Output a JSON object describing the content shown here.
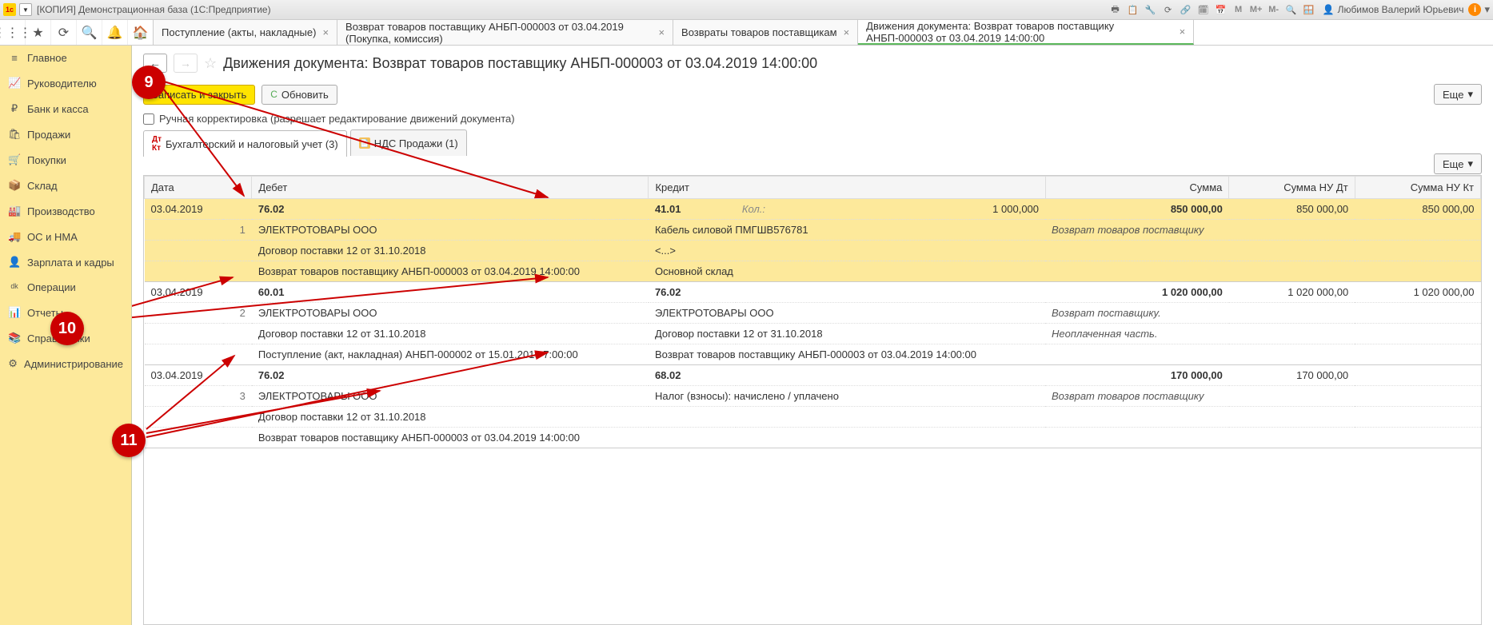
{
  "title_bar": {
    "title": "[КОПИЯ] Демонстрационная база  (1С:Предприятие)",
    "user": "Любимов Валерий Юрьевич",
    "m_icons": [
      "М",
      "М+",
      "М-"
    ]
  },
  "top_tabs": [
    {
      "label": "Поступление (акты, накладные)"
    },
    {
      "label": "Возврат товаров поставщику АНБП-000003 от 03.04.2019 (Покупка, комиссия)"
    },
    {
      "label": "Возвраты товаров поставщикам"
    },
    {
      "label": "Движения документа: Возврат товаров поставщику АНБП-000003 от 03.04.2019 14:00:00",
      "active": true
    }
  ],
  "sidebar": {
    "items": [
      {
        "icon": "≡",
        "label": "Главное"
      },
      {
        "icon": "📈",
        "label": "Руководителю"
      },
      {
        "icon": "₽",
        "label": "Банк и касса"
      },
      {
        "icon": "🛍",
        "label": "Продажи"
      },
      {
        "icon": "🛒",
        "label": "Покупки"
      },
      {
        "icon": "📦",
        "label": "Склад"
      },
      {
        "icon": "🏭",
        "label": "Производство"
      },
      {
        "icon": "🚚",
        "label": "ОС и НМА"
      },
      {
        "icon": "👤",
        "label": "Зарплата и кадры"
      },
      {
        "icon": "ᵈᵏ",
        "label": "Операции"
      },
      {
        "icon": "📊",
        "label": "Отчеты"
      },
      {
        "icon": "📚",
        "label": "Справочники"
      },
      {
        "icon": "⚙",
        "label": "Администрирование"
      }
    ]
  },
  "page": {
    "title": "Движения документа: Возврат товаров поставщику АНБП-000003 от 03.04.2019 14:00:00",
    "save_close": "Записать и закрыть",
    "refresh": "Обновить",
    "more": "Еще",
    "manual_correction": "Ручная корректировка (разрешает редактирование движений документа)"
  },
  "subtabs": [
    {
      "label": "Бухгалтерский и налоговый учет (3)",
      "active": true
    },
    {
      "label": "НДС Продажи (1)"
    }
  ],
  "table": {
    "headers": {
      "date": "Дата",
      "debit": "Дебет",
      "credit": "Кредит",
      "sum": "Сумма",
      "nudt": "Сумма НУ Дт",
      "nukt": "Сумма НУ Кт"
    },
    "qty_label": "Кол.:",
    "subconto_placeholder": "<...>",
    "rows": [
      {
        "n": "1",
        "date": "03.04.2019",
        "debit_acc": "76.02",
        "credit_acc": "41.01",
        "qty": "1 000,000",
        "sum": "850 000,00",
        "nudt": "850 000,00",
        "nukt": "850 000,00",
        "comment": "Возврат товаров поставщику",
        "hl": true,
        "debit_lines": [
          "ЭЛЕКТРОТОВАРЫ ООО",
          "Договор поставки 12 от 31.10.2018",
          "Возврат товаров поставщику АНБП-000003 от 03.04.2019 14:00:00"
        ],
        "credit_lines": [
          "Кабель силовой ПМГШВ576781",
          "<...>",
          "Основной склад"
        ]
      },
      {
        "n": "2",
        "date": "03.04.2019",
        "debit_acc": "60.01",
        "credit_acc": "76.02",
        "sum": "1 020 000,00",
        "nudt": "1 020 000,00",
        "nukt": "1 020 000,00",
        "comment": "Возврат поставщику.",
        "comment2": "Неоплаченная часть.",
        "debit_lines": [
          "ЭЛЕКТРОТОВАРЫ ООО",
          "Договор поставки 12 от 31.10.2018",
          "Поступление (акт, накладная) АНБП-000002 от 15.01.2019 7:00:00"
        ],
        "credit_lines": [
          "ЭЛЕКТРОТОВАРЫ ООО",
          "Договор поставки 12 от 31.10.2018",
          "Возврат товаров поставщику АНБП-000003 от 03.04.2019 14:00:00"
        ]
      },
      {
        "n": "3",
        "date": "03.04.2019",
        "debit_acc": "76.02",
        "credit_acc": "68.02",
        "sum": "170 000,00",
        "nudt": "170 000,00",
        "comment": "Возврат товаров поставщику",
        "debit_lines": [
          "ЭЛЕКТРОТОВАРЫ ООО",
          "Договор поставки 12 от 31.10.2018",
          "Возврат товаров поставщику АНБП-000003 от 03.04.2019 14:00:00"
        ],
        "credit_lines": [
          "Налог (взносы): начислено / уплачено"
        ]
      }
    ]
  },
  "callouts": {
    "c9": "9",
    "c10": "10",
    "c11": "11"
  }
}
